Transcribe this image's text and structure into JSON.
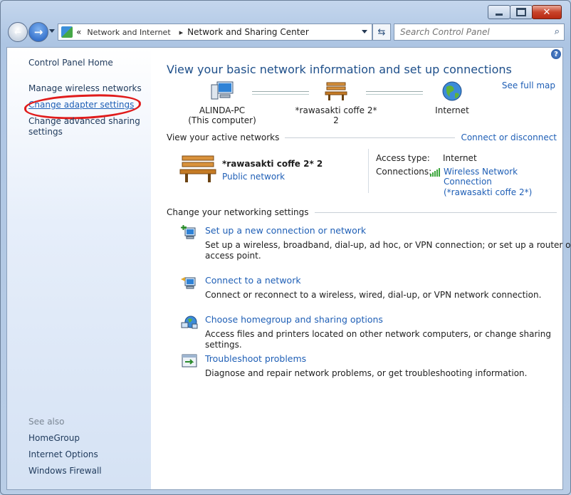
{
  "window": {
    "breadcrumb_prefix": "«",
    "breadcrumb": [
      "Network and Internet",
      "Network and Sharing Center"
    ],
    "breadcrumb_sep": "▸",
    "search_placeholder": "Search Control Panel"
  },
  "sidebar": {
    "home": "Control Panel Home",
    "links": [
      "Manage wireless networks",
      "Change adapter settings",
      "Change advanced sharing settings"
    ],
    "see_also_label": "See also",
    "see_also": [
      "HomeGroup",
      "Internet Options",
      "Windows Firewall"
    ]
  },
  "main": {
    "title": "View your basic network information and set up connections",
    "see_full_map": "See full map",
    "map": {
      "computer_name": "ALINDA-PC",
      "computer_sub": "(This computer)",
      "network_name": "*rawasakti coffe 2*  2",
      "internet": "Internet"
    },
    "active_networks_label": "View your active networks",
    "connect_or_disconnect": "Connect or disconnect",
    "active_network": {
      "name": "*rawasakti coffe 2*  2",
      "type": "Public network",
      "access_type_label": "Access type:",
      "access_type_value": "Internet",
      "connections_label": "Connections:",
      "connection_link_line1": "Wireless Network Connection",
      "connection_link_line2": "(*rawasakti coffe 2*)"
    },
    "change_settings_label": "Change your networking settings",
    "tasks": [
      {
        "link": "Set up a new connection or network",
        "desc": "Set up a wireless, broadband, dial-up, ad hoc, or VPN connection; or set up a router or access point."
      },
      {
        "link": "Connect to a network",
        "desc": "Connect or reconnect to a wireless, wired, dial-up, or VPN network connection."
      },
      {
        "link": "Choose homegroup and sharing options",
        "desc": "Access files and printers located on other network computers, or change sharing settings."
      },
      {
        "link": "Troubleshoot problems",
        "desc": "Diagnose and repair network problems, or get troubleshooting information."
      }
    ]
  },
  "colors": {
    "link": "#1f5fb6",
    "title": "#1e4f8a",
    "annotation": "#e01b1b"
  }
}
